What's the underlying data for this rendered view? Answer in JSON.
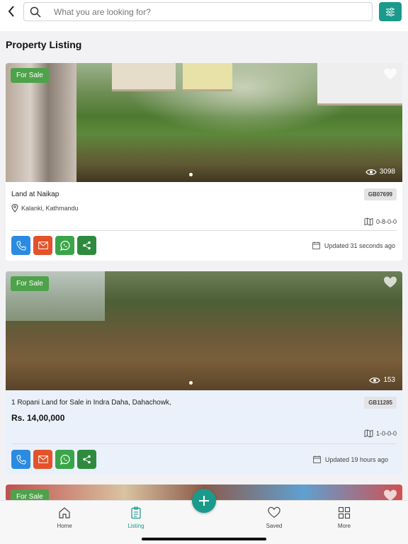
{
  "header": {
    "search_placeholder": "What you are looking for?",
    "grab_handle": "•••"
  },
  "page": {
    "title": "Property Listing"
  },
  "listings": [
    {
      "badge": "For Sale",
      "views": "3098",
      "title": "Land at Naikap",
      "code": "GB07699",
      "location": "Kalanki, Kathmandu",
      "area": "0-8-0-0",
      "updated": "Updated 31 seconds ago"
    },
    {
      "badge": "For Sale",
      "views": "153",
      "title": "1 Ropani Land for Sale in Indra Daha, Dahachowk,",
      "code": "GB11285",
      "price": "Rs. 14,00,000",
      "area": "1-0-0-0",
      "updated": "Updated 19 hours ago"
    },
    {
      "badge": "For Sale"
    }
  ],
  "tabbar": {
    "home": "Home",
    "listing": "Listing",
    "saved": "Saved",
    "more": "More",
    "active": "listing",
    "accent": "#1a9a8a"
  },
  "colors": {
    "sale_badge": "#4ea24a",
    "phone": "#2c8be0",
    "mail": "#e4522a",
    "whatsapp": "#3aa548",
    "share": "#2e8b3d"
  }
}
